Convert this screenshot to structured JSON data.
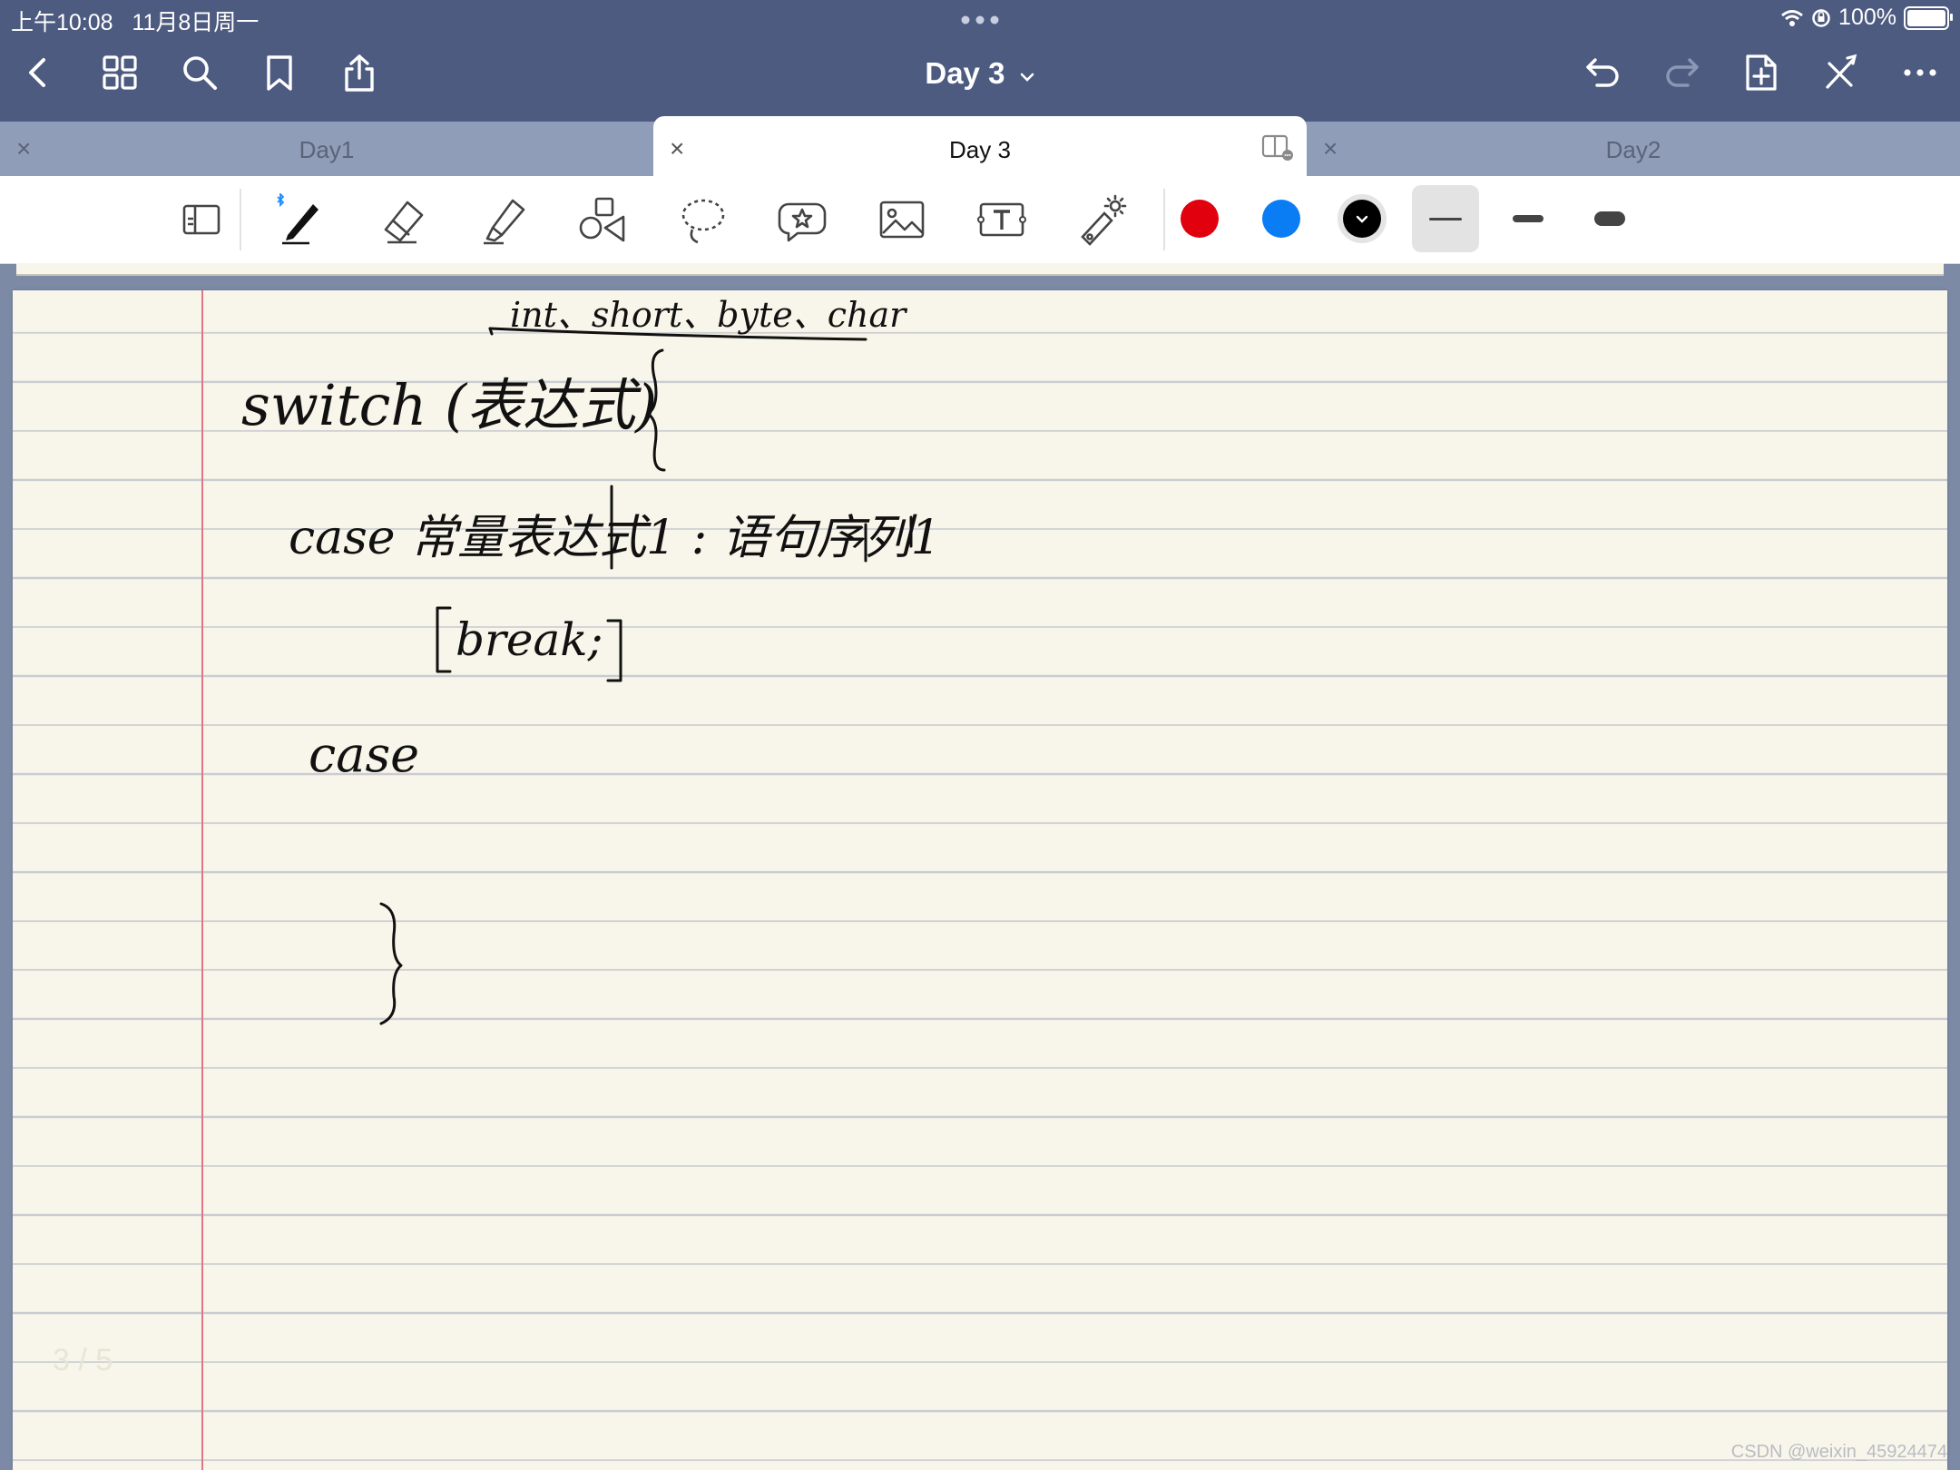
{
  "status_bar": {
    "time": "上午10:08",
    "date": "11月8日周一",
    "battery": "100%"
  },
  "header": {
    "title": "Day 3"
  },
  "tabs": [
    {
      "label": "Day1",
      "active": false
    },
    {
      "label": "Day 3",
      "active": true
    },
    {
      "label": "Day2",
      "active": false
    }
  ],
  "toolbar": {
    "tools": [
      "layout-icon",
      "pen-icon",
      "eraser-icon",
      "highlighter-icon",
      "shapes-icon",
      "lasso-icon",
      "sticker-icon",
      "image-icon",
      "text-icon",
      "laser-pointer-icon"
    ],
    "colors": [
      "#e0000e",
      "#0a7df5",
      "#000000"
    ],
    "widths": [
      "thin",
      "medium",
      "thick"
    ]
  },
  "page": {
    "page_number": "3 / 5",
    "handwriting": [
      "int、short、byte、char",
      "switch (表达式) {",
      "case 常量表达式1 : 语句序列1",
      "[break;]",
      "case",
      "}"
    ]
  },
  "watermark": "CSDN @weixin_45924474"
}
